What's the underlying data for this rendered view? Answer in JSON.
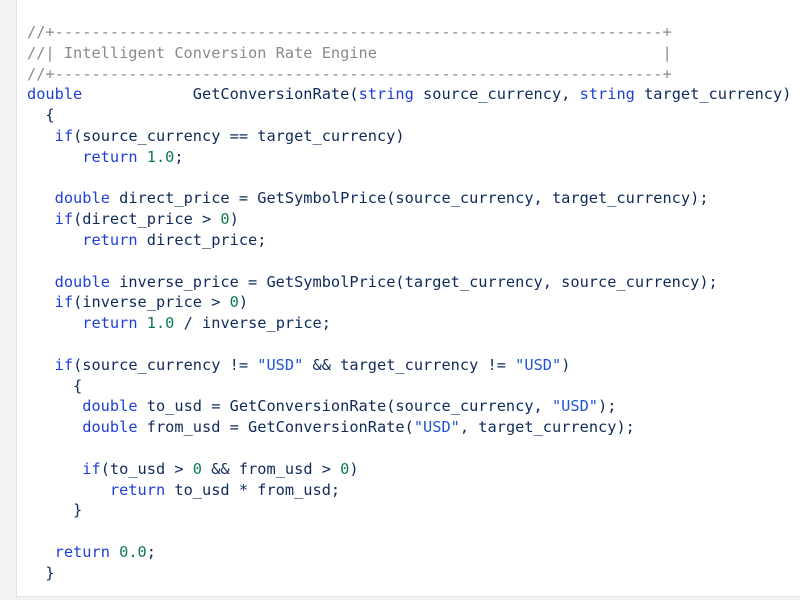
{
  "editor": {
    "colors": {
      "background": "#ffffff",
      "comment": "#8a8a8a",
      "keyword": "#1e3fd8",
      "number": "#0b7a4e",
      "string": "#1f55d6",
      "identifier": "#0f2a5a"
    },
    "lines": [
      [
        [
          "c",
          "//+------------------------------------------------------------------+"
        ]
      ],
      [
        [
          "c",
          "//| Intelligent Conversion Rate Engine                               |"
        ]
      ],
      [
        [
          "c",
          "//+------------------------------------------------------------------+"
        ]
      ],
      [
        [
          "k",
          "double"
        ],
        [
          "i",
          "            GetConversionRate("
        ],
        [
          "k",
          "string"
        ],
        [
          "i",
          " source_currency, "
        ],
        [
          "k",
          "string"
        ],
        [
          "i",
          " target_currency)"
        ]
      ],
      [
        [
          "i",
          "  {"
        ]
      ],
      [
        [
          "i",
          "   "
        ],
        [
          "k",
          "if"
        ],
        [
          "i",
          "(source_currency == target_currency)"
        ]
      ],
      [
        [
          "i",
          "      "
        ],
        [
          "k",
          "return"
        ],
        [
          "i",
          " "
        ],
        [
          "n",
          "1.0"
        ],
        [
          "i",
          ";"
        ]
      ],
      [
        [
          "i",
          ""
        ]
      ],
      [
        [
          "i",
          "   "
        ],
        [
          "k",
          "double"
        ],
        [
          "i",
          " direct_price = GetSymbolPrice(source_currency, target_currency);"
        ]
      ],
      [
        [
          "i",
          "   "
        ],
        [
          "k",
          "if"
        ],
        [
          "i",
          "(direct_price > "
        ],
        [
          "n",
          "0"
        ],
        [
          "i",
          ")"
        ]
      ],
      [
        [
          "i",
          "      "
        ],
        [
          "k",
          "return"
        ],
        [
          "i",
          " direct_price;"
        ]
      ],
      [
        [
          "i",
          ""
        ]
      ],
      [
        [
          "i",
          "   "
        ],
        [
          "k",
          "double"
        ],
        [
          "i",
          " inverse_price = GetSymbolPrice(target_currency, source_currency);"
        ]
      ],
      [
        [
          "i",
          "   "
        ],
        [
          "k",
          "if"
        ],
        [
          "i",
          "(inverse_price > "
        ],
        [
          "n",
          "0"
        ],
        [
          "i",
          ")"
        ]
      ],
      [
        [
          "i",
          "      "
        ],
        [
          "k",
          "return"
        ],
        [
          "i",
          " "
        ],
        [
          "n",
          "1.0"
        ],
        [
          "i",
          " / inverse_price;"
        ]
      ],
      [
        [
          "i",
          ""
        ]
      ],
      [
        [
          "i",
          "   "
        ],
        [
          "k",
          "if"
        ],
        [
          "i",
          "(source_currency != "
        ],
        [
          "s",
          "\"USD\""
        ],
        [
          "i",
          " && target_currency != "
        ],
        [
          "s",
          "\"USD\""
        ],
        [
          "i",
          ")"
        ]
      ],
      [
        [
          "i",
          "     {"
        ]
      ],
      [
        [
          "i",
          "      "
        ],
        [
          "k",
          "double"
        ],
        [
          "i",
          " to_usd = GetConversionRate(source_currency, "
        ],
        [
          "s",
          "\"USD\""
        ],
        [
          "i",
          ");"
        ]
      ],
      [
        [
          "i",
          "      "
        ],
        [
          "k",
          "double"
        ],
        [
          "i",
          " from_usd = GetConversionRate("
        ],
        [
          "s",
          "\"USD\""
        ],
        [
          "i",
          ", target_currency);"
        ]
      ],
      [
        [
          "i",
          ""
        ]
      ],
      [
        [
          "i",
          "      "
        ],
        [
          "k",
          "if"
        ],
        [
          "i",
          "(to_usd > "
        ],
        [
          "n",
          "0"
        ],
        [
          "i",
          " && from_usd > "
        ],
        [
          "n",
          "0"
        ],
        [
          "i",
          ")"
        ]
      ],
      [
        [
          "i",
          "         "
        ],
        [
          "k",
          "return"
        ],
        [
          "i",
          " to_usd * from_usd;"
        ]
      ],
      [
        [
          "i",
          "     }"
        ]
      ],
      [
        [
          "i",
          ""
        ]
      ],
      [
        [
          "i",
          "   "
        ],
        [
          "k",
          "return"
        ],
        [
          "i",
          " "
        ],
        [
          "n",
          "0.0"
        ],
        [
          "i",
          ";"
        ]
      ],
      [
        [
          "i",
          "  }"
        ]
      ]
    ]
  }
}
